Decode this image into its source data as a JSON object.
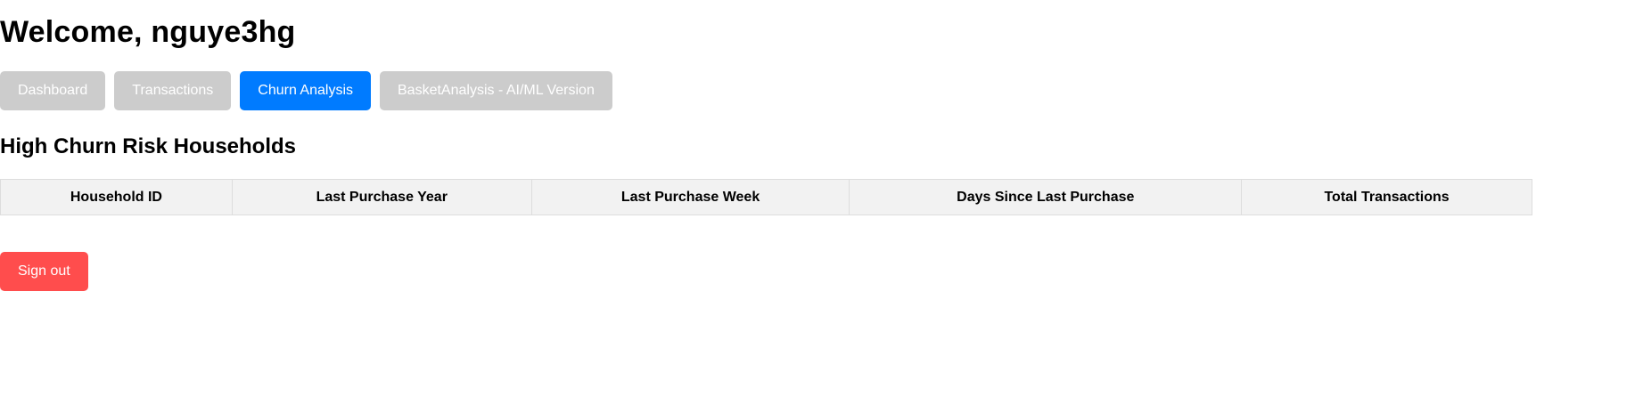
{
  "header": {
    "welcome": "Welcome, nguye3hg"
  },
  "nav": {
    "tabs": [
      {
        "label": "Dashboard",
        "active": false
      },
      {
        "label": "Transactions",
        "active": false
      },
      {
        "label": "Churn Analysis",
        "active": true
      },
      {
        "label": "BasketAnalysis - AI/ML Version",
        "active": false
      }
    ]
  },
  "main": {
    "title": "High Churn Risk Households",
    "table": {
      "columns": [
        "Household ID",
        "Last Purchase Year",
        "Last Purchase Week",
        "Days Since Last Purchase",
        "Total Transactions"
      ],
      "rows": []
    }
  },
  "footer": {
    "signout_label": "Sign out"
  },
  "colors": {
    "active_tab": "#007bff",
    "inactive_tab": "#cccccc",
    "signout": "#ff4d4d",
    "table_header_bg": "#f2f2f2",
    "table_border": "#dddddd"
  }
}
